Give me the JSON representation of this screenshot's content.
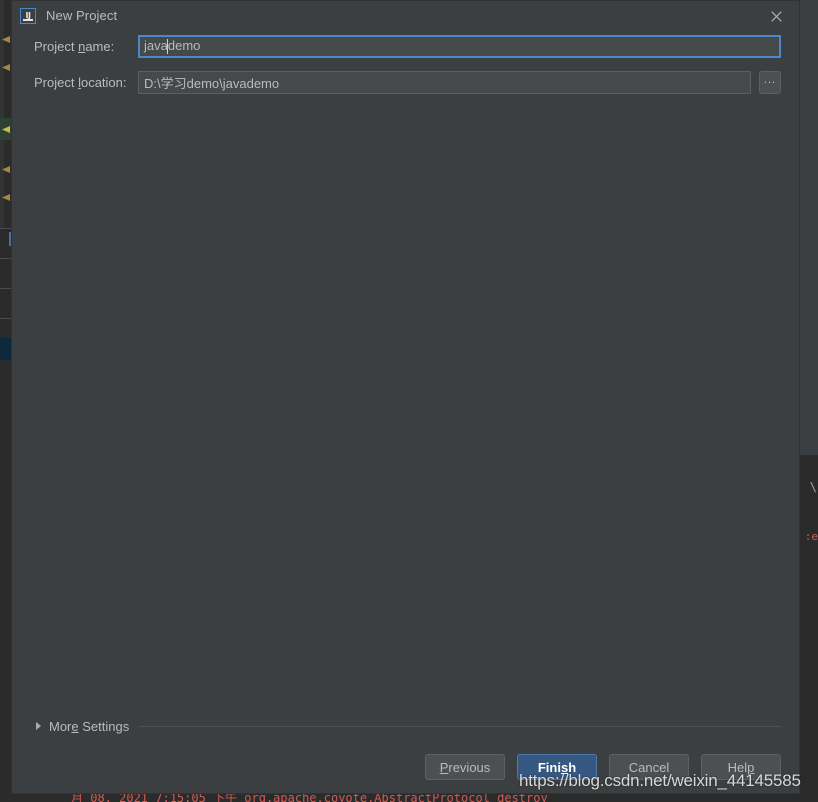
{
  "window": {
    "title": "New Project",
    "app_icon": "intellij-idea-icon",
    "close_icon": "close-icon"
  },
  "form": {
    "project_name": {
      "label_before": "Project ",
      "label_mnemonic": "n",
      "label_after": "ame:",
      "label_full": "Project name:",
      "value_before_caret": "java",
      "value_after_caret": "demo",
      "value": "javademo"
    },
    "project_location": {
      "label_before": "Project ",
      "label_mnemonic": "l",
      "label_after": "ocation:",
      "label_full": "Project location:",
      "value": "D:\\学习demo\\javademo",
      "browse_button_label": "...",
      "browse_icon": "ellipsis-icon"
    }
  },
  "more_settings": {
    "label_before": "Mor",
    "label_mnemonic": "e",
    "label_after": " Settings",
    "label_full": "More Settings",
    "expander_icon": "chevron-right-icon",
    "expanded": false
  },
  "buttons": {
    "previous": {
      "before": "",
      "mnemonic": "P",
      "after": "revious",
      "full": "Previous"
    },
    "finish": {
      "before": "Fini",
      "mnemonic": "s",
      "after": "h",
      "full": "Finish"
    },
    "cancel": {
      "before": "",
      "mnemonic": "",
      "after": "Cancel",
      "full": "Cancel"
    },
    "help": {
      "before": "Hel",
      "mnemonic": "p",
      "after": "",
      "full": "Help"
    }
  },
  "watermark": {
    "text": "https://blog.csdn.net/weixin_44145585"
  },
  "background": {
    "console_text": "月 08, 2021 7:15:05 下午 org.apache.coyote.AbstractProtocol destroy",
    "right_fragment": ":e",
    "right_slash": "\\"
  },
  "colors": {
    "dialog_bg": "#3c3f41",
    "accent_blue": "#4a88c7",
    "primary_button": "#365880",
    "text": "#bbbbbb",
    "field_bg": "#45494a",
    "console_red": "#cf5b56",
    "ide_editor_bg": "#2b2b2b"
  }
}
